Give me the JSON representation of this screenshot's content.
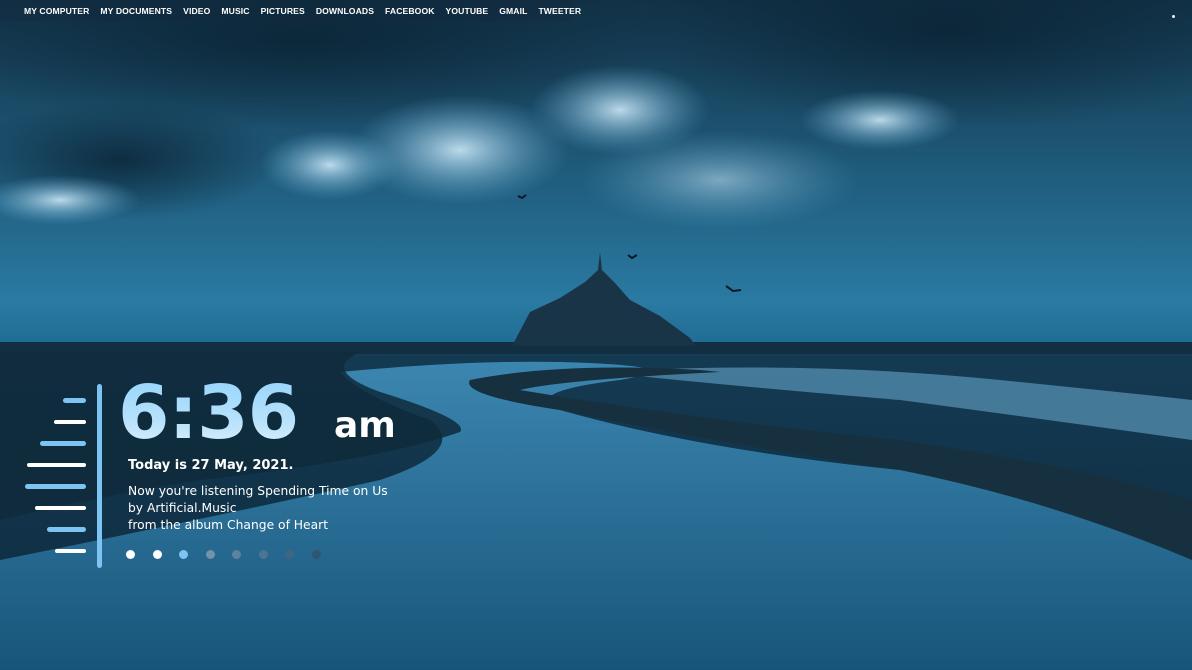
{
  "menu": {
    "items": [
      "MY COMPUTER",
      "MY DOCUMENTS",
      "VIDEO",
      "MUSIC",
      "PICTURES",
      "DOWNLOADS",
      "FACEBOOK",
      "YOUTUBE",
      "GMAIL",
      "TWEETER"
    ]
  },
  "clock": {
    "time": "6:36",
    "ampm": "am",
    "date_text": "Today is 27 May, 2021."
  },
  "music": {
    "line1": "Now you're listening Spending Time on Us",
    "line2": "by Artificial.Music",
    "line3": "from the album Change of Heart"
  },
  "visualizer": {
    "bar_color_light": "#ffffff",
    "bar_color_blue": "#7ec4f2",
    "levels": [
      0.36,
      0.5,
      0.72,
      0.92,
      0.95,
      0.8,
      0.61,
      0.49
    ],
    "colors": [
      "blue",
      "white",
      "blue",
      "white",
      "blue",
      "white",
      "blue",
      "white"
    ]
  },
  "pager": {
    "count": 8,
    "active_index": 2,
    "colors": [
      "#ffffff",
      "#ffffff",
      "#7ec4f2",
      "#7393ab",
      "#5f829c",
      "#4f7390",
      "#3f6680",
      "#2f566f"
    ]
  },
  "theme": {
    "accent": "#7ec4f2"
  }
}
